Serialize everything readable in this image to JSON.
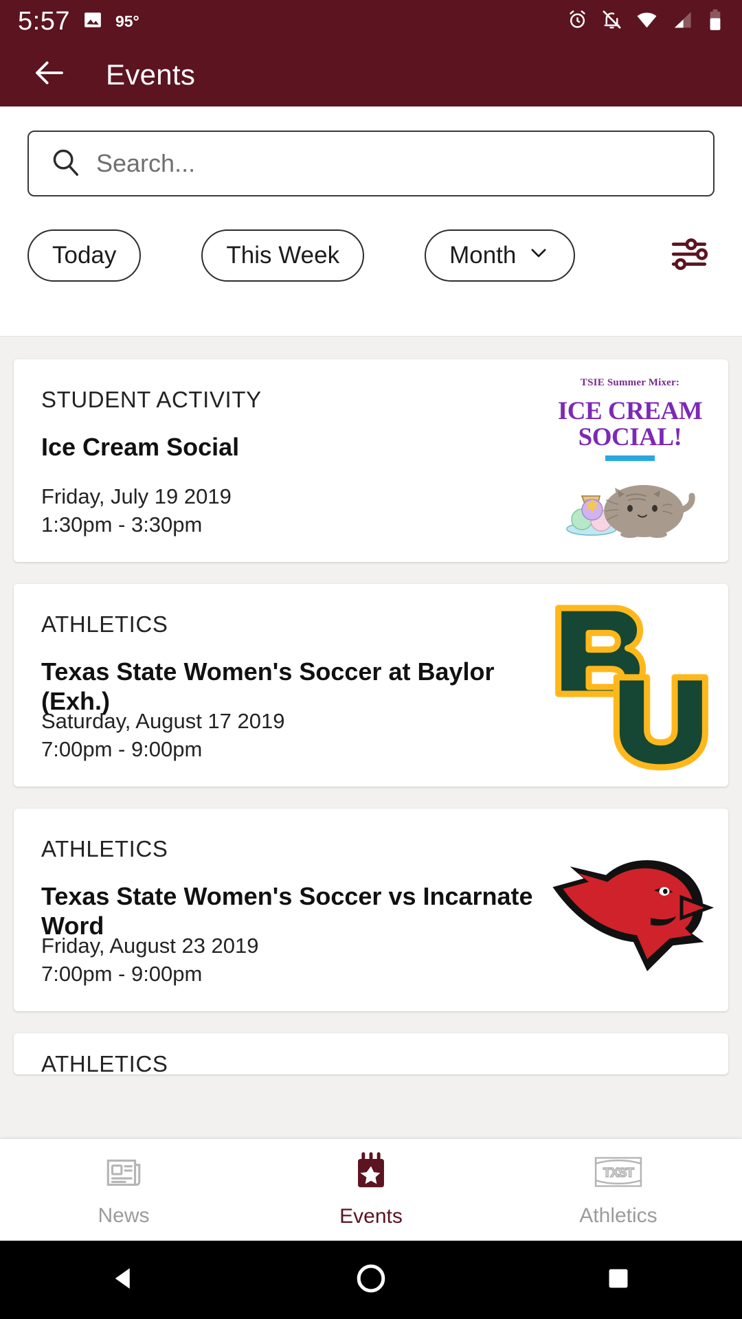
{
  "status_bar": {
    "time": "5:57",
    "temperature": "95°",
    "icons": [
      "image-icon",
      "alarm-icon",
      "notifications-off-icon",
      "wifi-icon",
      "cellular-signal-icon",
      "battery-icon"
    ]
  },
  "app_bar": {
    "title": "Events",
    "back_icon": "arrow-left-icon"
  },
  "search": {
    "placeholder": "Search...",
    "value": "",
    "icon": "search-icon"
  },
  "filters": {
    "chips": [
      {
        "label": "Today",
        "has_chevron": false
      },
      {
        "label": "This Week",
        "has_chevron": false
      },
      {
        "label": "Month",
        "has_chevron": true
      }
    ],
    "filter_icon": "sliders-icon",
    "filter_icon_color": "#5b1420"
  },
  "events": [
    {
      "category": "STUDENT ACTIVITY",
      "title": "Ice Cream Social",
      "date": "Friday, July 19 2019",
      "time": "1:30pm - 3:30pm",
      "thumbnail": {
        "kind": "poster",
        "pre_title": "TSIE Summer Mixer:",
        "line1": "ICE CREAM",
        "line2": "SOCIAL!",
        "accent_color": "#7d29b5",
        "rule_color": "#27a8e0"
      }
    },
    {
      "category": "ATHLETICS",
      "title": "Texas State Women's Soccer at Baylor (Exh.)",
      "date": "Saturday, August 17 2019",
      "time": "7:00pm - 9:00pm",
      "thumbnail": {
        "kind": "baylor-logo",
        "alt": "Baylor University BU logo",
        "primary_color": "#154734",
        "accent_color": "#FFB81C"
      }
    },
    {
      "category": "ATHLETICS",
      "title": "Texas State Women's Soccer vs Incarnate Word",
      "date": "Friday, August 23 2019",
      "time": "7:00pm - 9:00pm",
      "thumbnail": {
        "kind": "cardinal-logo",
        "alt": "Incarnate Word Cardinals logo",
        "primary_color": "#d0222a"
      }
    },
    {
      "category": "ATHLETICS",
      "title": "",
      "date": "",
      "time": "",
      "thumbnail": {
        "kind": "none",
        "alt": ""
      }
    }
  ],
  "bottom_nav": {
    "active_color": "#5b1420",
    "inactive_color": "#9b9b9b",
    "items": [
      {
        "label": "News",
        "icon": "newspaper-icon",
        "active": false
      },
      {
        "label": "Events",
        "icon": "calendar-star-icon",
        "active": true
      },
      {
        "label": "Athletics",
        "icon": "txst-logo-icon",
        "active": false
      }
    ]
  },
  "system_nav": {
    "buttons": [
      {
        "name": "back",
        "icon": "triangle-back-icon"
      },
      {
        "name": "home",
        "icon": "circle-home-icon"
      },
      {
        "name": "recents",
        "icon": "square-recents-icon"
      }
    ]
  },
  "theme": {
    "brand_maroon": "#5b1420",
    "page_bg": "#f2f1ef",
    "card_bg": "#ffffff"
  }
}
